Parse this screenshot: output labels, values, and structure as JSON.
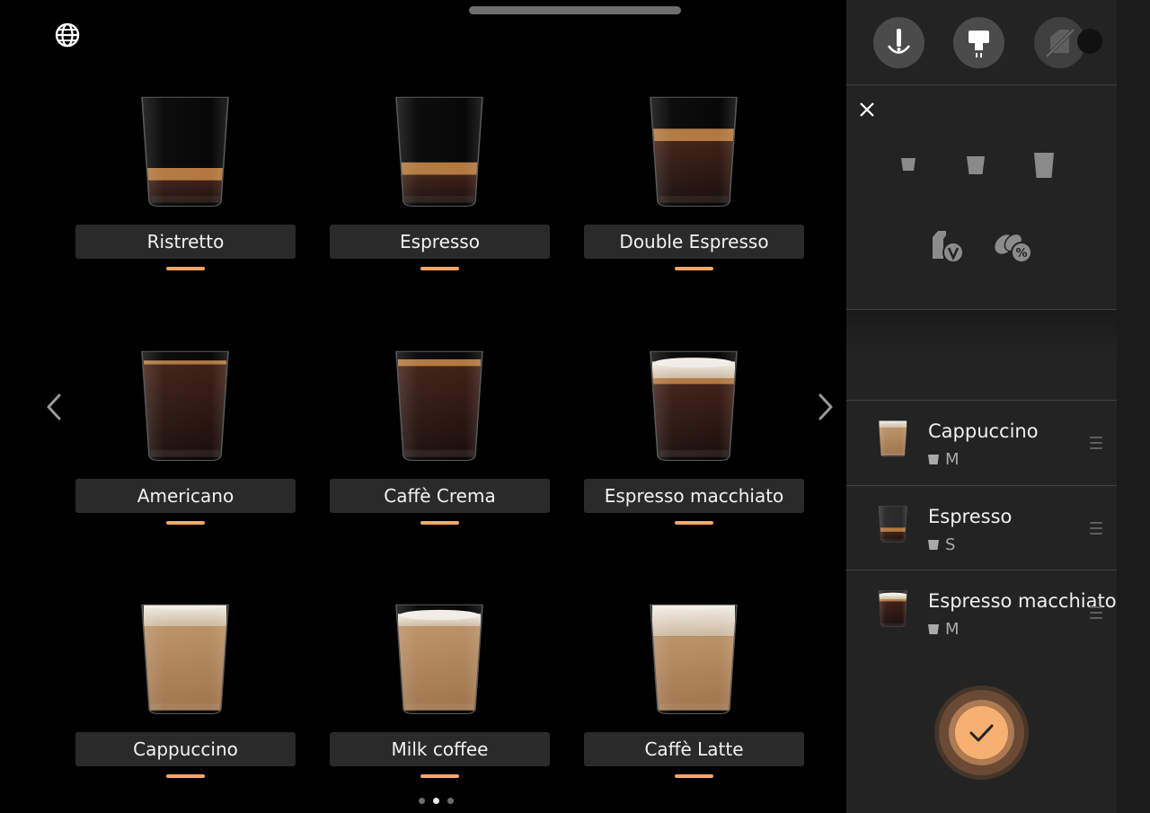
{
  "drinks": [
    {
      "name": "Ristretto",
      "type": "ristretto"
    },
    {
      "name": "Espresso",
      "type": "espresso"
    },
    {
      "name": "Double Espresso",
      "type": "double"
    },
    {
      "name": "Americano",
      "type": "americano"
    },
    {
      "name": "Caffè Crema",
      "type": "crema"
    },
    {
      "name": "Espresso macchiato",
      "type": "macchiato"
    },
    {
      "name": "Cappuccino",
      "type": "cappuccino"
    },
    {
      "name": "Milk coffee",
      "type": "milkcoffee"
    },
    {
      "name": "Caffè Latte",
      "type": "latte"
    }
  ],
  "pagination": {
    "pages": 3,
    "current": 2
  },
  "panel": {
    "header_icons": [
      "hot-water-icon",
      "brew-unit-icon",
      "milk-off-icon"
    ],
    "cup_sizes": [
      "S",
      "M",
      "L"
    ],
    "options": [
      "vegan-milk-icon",
      "bean-strength-icon"
    ],
    "queue": [
      {
        "name": "Cappuccino",
        "size": "M",
        "type": "cappuccino"
      },
      {
        "name": "Espresso",
        "size": "S",
        "type": "espresso"
      },
      {
        "name": "Espresso macchiato",
        "size": "M",
        "type": "macchiato"
      }
    ]
  },
  "colors": {
    "accent": "#f5a66a",
    "panel_bg": "#232323",
    "label_bg": "#2a2a2a"
  }
}
